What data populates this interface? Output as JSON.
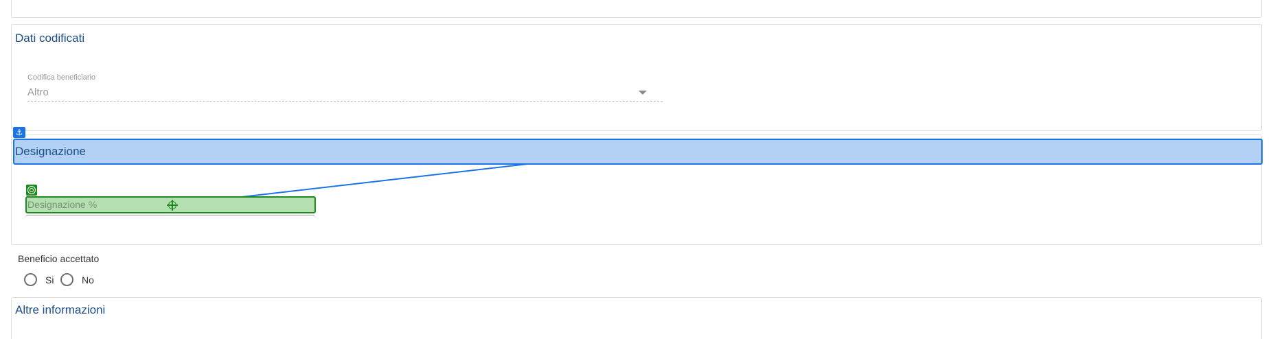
{
  "dati_codificati": {
    "title": "Dati codificati",
    "codifica_beneficiario": {
      "label": "Codifica beneficiario",
      "value": "Altro"
    }
  },
  "designazione": {
    "title": "Designazione",
    "field": {
      "placeholder": "Designazione %"
    }
  },
  "beneficio_accettato": {
    "label": "Beneficio accettato",
    "options": [
      "Si",
      "No"
    ]
  },
  "altre_informazioni": {
    "title": "Altre informazioni"
  },
  "overlay": {
    "anchor_icon": "anchor-icon",
    "target_icon": "target-icon",
    "crosshair_icon": "crosshair-icon",
    "source_color": "#1a73e8",
    "target_color": "#1e8a1e"
  }
}
